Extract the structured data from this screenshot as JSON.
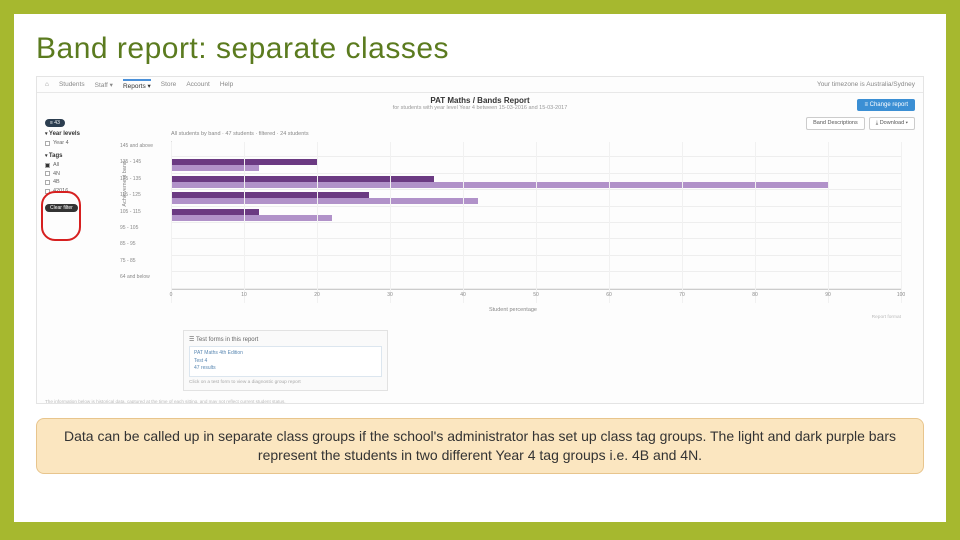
{
  "slide": {
    "title": "Band report: separate classes",
    "caption": "Data can be called up in separate class groups if the school's administrator has set up class tag groups. The light and dark purple bars represent the students in two different Year 4 tag groups i.e. 4B and 4N."
  },
  "nav": {
    "items": [
      "Students",
      "Staff ▾",
      "Reports ▾",
      "Store",
      "Account",
      "Help"
    ],
    "active_index": 2,
    "timezone": "Your timezone is Australia/Sydney"
  },
  "report": {
    "title": "PAT Maths / Bands Report",
    "subtitle": "for students with year level Year 4 between 15-03-2016 and 15-03-2017",
    "change_btn": "≡ Change report",
    "band_desc_btn": "Band Descriptions",
    "download_btn": "⤓ Download ▾",
    "count_pill": "≡ 43",
    "chart_subtitle": "All students by band · 47 students · filtered · 24 students",
    "footnote": "Report format",
    "info_line": "The information below is historical data, captured at the time of each sitting, and may not reflect current student status."
  },
  "filters": {
    "year_head": "Year levels",
    "year_items": [
      {
        "label": "Year 4",
        "checked": false
      }
    ],
    "tags_head": "Tags",
    "tag_items": [
      {
        "label": "All",
        "checked": true
      },
      {
        "label": "4N",
        "checked": false
      },
      {
        "label": "4B",
        "checked": false
      },
      {
        "label": "42016",
        "checked": false
      }
    ],
    "clear": "Clear filter"
  },
  "forms_box": {
    "head": "☰ Test forms in this report",
    "lines": [
      "PAT Maths 4th Edition",
      "Test 4",
      "47 results"
    ],
    "hint": "Click on a test form to view a diagnostic group report"
  },
  "chart_data": {
    "type": "bar",
    "orientation": "horizontal",
    "title": "All students by band",
    "ylabel": "Achievement band",
    "xlabel": "Student percentage",
    "xlim": [
      0,
      100
    ],
    "xticks": [
      0,
      10,
      20,
      30,
      40,
      50,
      60,
      70,
      80,
      90,
      100
    ],
    "categories": [
      "145 and above",
      "135 - 145",
      "125 - 135",
      "115 - 125",
      "105 - 115",
      "95 - 105",
      "85 - 95",
      "75 - 85",
      "64 and below"
    ],
    "series": [
      {
        "name": "4B (dark purple)",
        "values": [
          0,
          20,
          36,
          27,
          12,
          0,
          0,
          0,
          0
        ]
      },
      {
        "name": "4N (light purple)",
        "values": [
          0,
          12,
          90,
          42,
          22,
          0,
          0,
          0,
          0
        ]
      }
    ]
  }
}
